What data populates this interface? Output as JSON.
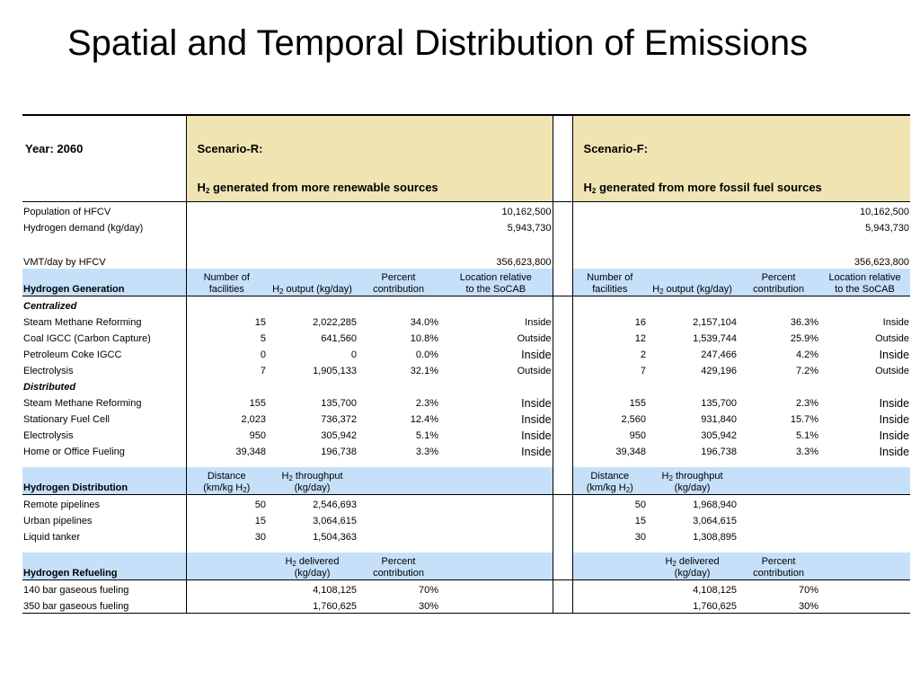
{
  "title": "Spatial and Temporal Distribution of Emissions",
  "header": {
    "year": "Year: 2060",
    "scenario_r": {
      "label": "Scenario-R:",
      "desc_pre": "H",
      "desc_sub": "2",
      "desc_post": " generated from more renewable sources"
    },
    "scenario_f": {
      "label": "Scenario-F:",
      "desc_pre": "H",
      "desc_sub": "2",
      "desc_post": " generated from more fossil fuel sources"
    }
  },
  "totals": [
    {
      "label": "Population of HFCV",
      "r": "10,162,500",
      "f": "10,162,500"
    },
    {
      "label": "Hydrogen demand (kg/day)",
      "r": "5,943,730",
      "f": "5,943,730"
    },
    {
      "label": "VMT/day by HFCV",
      "r": "356,623,800",
      "f": "356,623,800"
    }
  ],
  "generation": {
    "title": "Hydrogen Generation",
    "columns": {
      "facilities_1": "Number of",
      "facilities_2": "facilities",
      "output_pre": "H",
      "output_sub": "2",
      "output_post": " output (kg/day)",
      "percent_1": "Percent",
      "percent_2": "contribution",
      "location_1": "Location relative",
      "location_2": "to the SoCAB"
    },
    "centralized_label": "Centralized",
    "centralized": [
      {
        "label": "Steam Methane Reforming",
        "r": [
          "15",
          "2,022,285",
          "34.0%",
          "Inside"
        ],
        "f": [
          "16",
          "2,157,104",
          "36.3%",
          "Inside"
        ]
      },
      {
        "label": "Coal IGCC (Carbon Capture)",
        "r": [
          "5",
          "641,560",
          "10.8%",
          "Outside"
        ],
        "f": [
          "12",
          "1,539,744",
          "25.9%",
          "Outside"
        ]
      },
      {
        "label": "Petroleum Coke IGCC",
        "r": [
          "0",
          "0",
          "0.0%",
          "Inside"
        ],
        "f": [
          "2",
          "247,466",
          "4.2%",
          "Inside"
        ]
      },
      {
        "label": "Electrolysis",
        "r": [
          "7",
          "1,905,133",
          "32.1%",
          "Outside"
        ],
        "f": [
          "7",
          "429,196",
          "7.2%",
          "Outside"
        ]
      }
    ],
    "distributed_label": "Distributed",
    "distributed": [
      {
        "label": "Steam Methane Reforming",
        "r": [
          "155",
          "135,700",
          "2.3%",
          "Inside"
        ],
        "f": [
          "155",
          "135,700",
          "2.3%",
          "Inside"
        ]
      },
      {
        "label": "Stationary Fuel Cell",
        "r": [
          "2,023",
          "736,372",
          "12.4%",
          "Inside"
        ],
        "f": [
          "2,560",
          "931,840",
          "15.7%",
          "Inside"
        ]
      },
      {
        "label": "Electrolysis",
        "r": [
          "950",
          "305,942",
          "5.1%",
          "Inside"
        ],
        "f": [
          "950",
          "305,942",
          "5.1%",
          "Inside"
        ]
      },
      {
        "label": "Home or Office Fueling",
        "r": [
          "39,348",
          "196,738",
          "3.3%",
          "Inside"
        ],
        "f": [
          "39,348",
          "196,738",
          "3.3%",
          "Inside"
        ]
      }
    ]
  },
  "distribution": {
    "title": "Hydrogen Distribution",
    "columns": {
      "distance_1": "Distance",
      "distance_2_pre": "(km/kg H",
      "distance_2_sub": "2",
      "distance_2_post": ")",
      "throughput_pre": "H",
      "throughput_sub": "2",
      "throughput_post": " throughput",
      "throughput_2": "(kg/day)"
    },
    "rows": [
      {
        "label": "Remote pipelines",
        "r": [
          "50",
          "2,546,693"
        ],
        "f": [
          "50",
          "1,968,940"
        ]
      },
      {
        "label": "Urban pipelines",
        "r": [
          "15",
          "3,064,615"
        ],
        "f": [
          "15",
          "3,064,615"
        ]
      },
      {
        "label": "Liquid tanker",
        "r": [
          "30",
          "1,504,363"
        ],
        "f": [
          "30",
          "1,308,895"
        ]
      }
    ]
  },
  "refueling": {
    "title": "Hydrogen Refueling",
    "columns": {
      "delivered_pre": "H",
      "delivered_sub": "2",
      "delivered_post": " delivered",
      "delivered_2": "(kg/day)",
      "percent_1": "Percent",
      "percent_2": "contribution"
    },
    "rows": [
      {
        "label": "140 bar gaseous fueling",
        "r": [
          "4,108,125",
          "70%"
        ],
        "f": [
          "4,108,125",
          "70%"
        ]
      },
      {
        "label": "350 bar gaseous fueling",
        "r": [
          "1,760,625",
          "30%"
        ],
        "f": [
          "1,760,625",
          "30%"
        ]
      }
    ]
  }
}
